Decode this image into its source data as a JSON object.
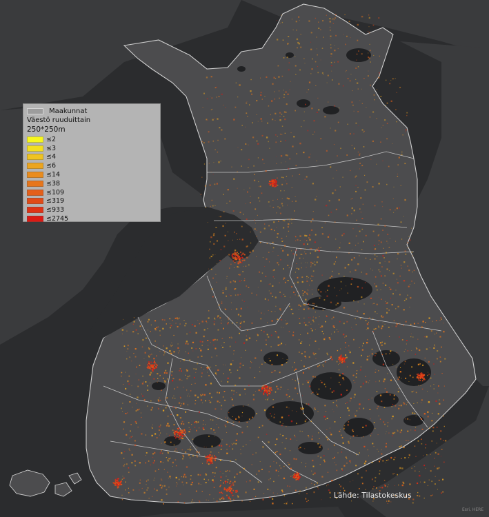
{
  "legend": {
    "boundary_label": "Maakunnat",
    "title": "Väestö ruuduittain",
    "subtitle": "250*250m",
    "classes": [
      {
        "label": "≤2",
        "color": "#f7f71d"
      },
      {
        "label": "≤3",
        "color": "#f3df1f"
      },
      {
        "label": "≤4",
        "color": "#efc321"
      },
      {
        "label": "≤6",
        "color": "#eca51f"
      },
      {
        "label": "≤14",
        "color": "#e98c1e"
      },
      {
        "label": "≤38",
        "color": "#e6761c"
      },
      {
        "label": "≤109",
        "color": "#e45f1a"
      },
      {
        "label": "≤319",
        "color": "#e14b18"
      },
      {
        "label": "≤933",
        "color": "#df3316"
      },
      {
        "label": "≤2745",
        "color": "#dc1a14"
      }
    ]
  },
  "credits": {
    "source": "Lähde: Tilastokeskus",
    "basemap": "Esri, HERE"
  },
  "colors": {
    "background": "#2b2c2e",
    "neighbor_land": "#3a3b3d",
    "finland_land": "#4c4c4e",
    "water": "#202123",
    "boundaries": "#d9d9d9"
  }
}
